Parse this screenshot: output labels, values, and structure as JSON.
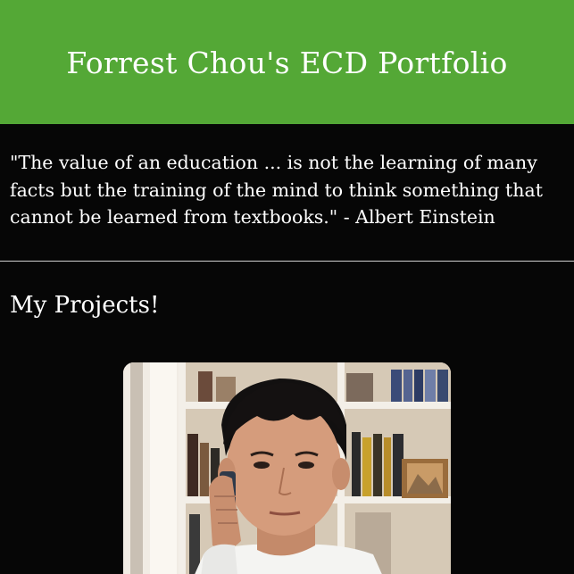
{
  "header": {
    "title": "Forrest Chou's ECD Portfolio",
    "background_color": "#54a836"
  },
  "quote": {
    "text": "\"The value of an education ... is not the learning of many facts but the training of the mind to think something that cannot be learned from textbooks.\" - Albert Einstein"
  },
  "projects": {
    "heading": "My Projects!"
  },
  "photo": {
    "subject": "portrait-photo"
  }
}
